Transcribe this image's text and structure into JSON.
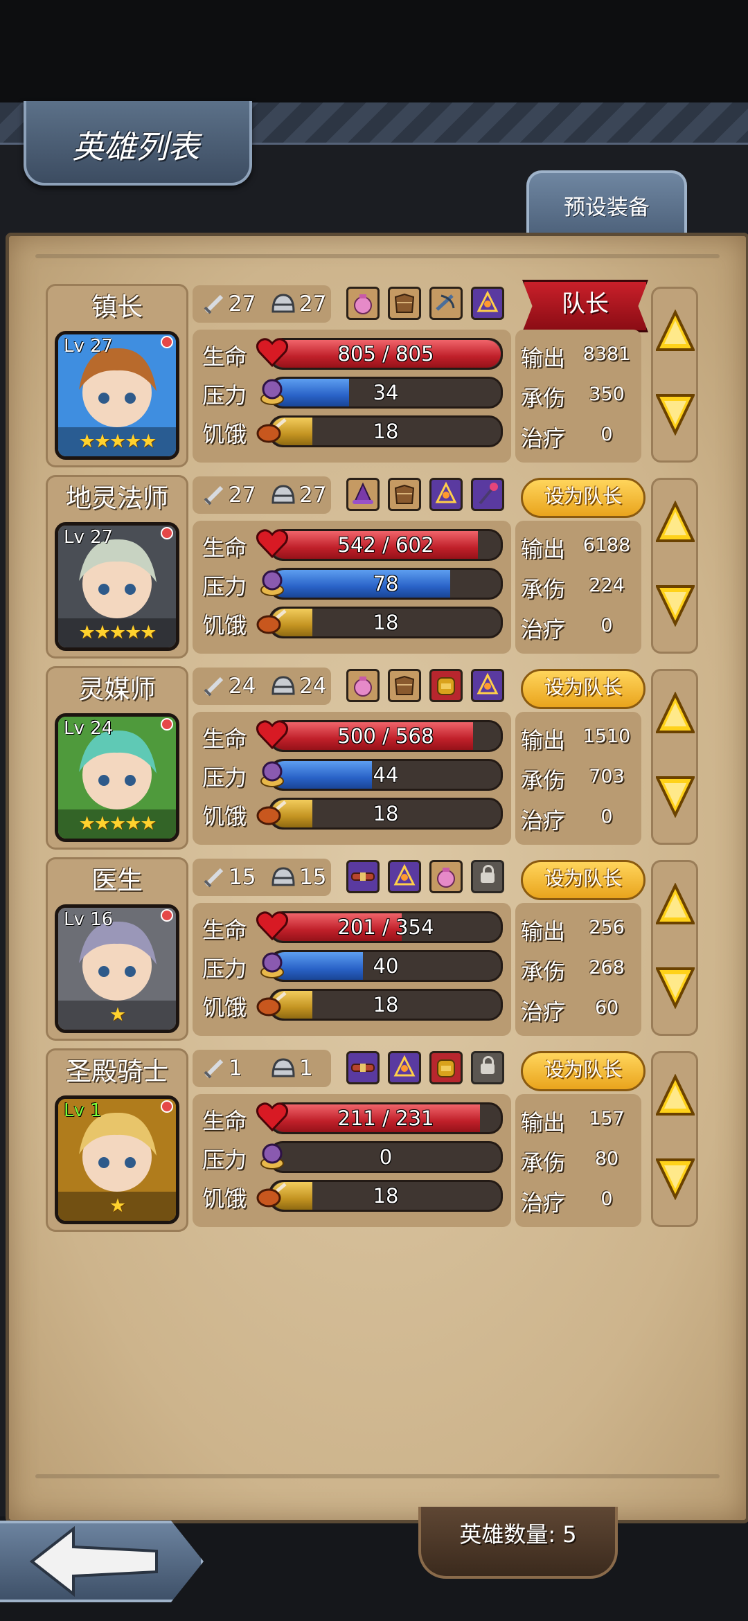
{
  "header": {
    "title": "英雄列表",
    "preset_button": "预设装备"
  },
  "labels": {
    "hp": "生命",
    "stress": "压力",
    "hunger": "饥饿",
    "output": "输出",
    "tank": "承伤",
    "heal": "治疗",
    "set_leader": "设为队长",
    "captain": "队长"
  },
  "colors": {
    "parchment": "#d4bd98",
    "hp_bar": "#c0202a",
    "stress_bar": "#2a63c8",
    "hunger_bar": "#c49422",
    "leader_gold": "#f0b73a",
    "captain_red": "#b0151d"
  },
  "heroes": [
    {
      "name": "镇长",
      "level": "Lv 27",
      "stars": "★★★★★",
      "attack": "27",
      "defense": "27",
      "is_captain": true,
      "equipment": [
        "pink-pouch-icon",
        "leather-armor-icon",
        "crossbow-icon",
        "rune-sigil-icon"
      ],
      "hp": "805 / 805",
      "hp_fraction": 1.0,
      "stress": "34",
      "stress_fraction": 0.34,
      "hunger": "18",
      "hunger_fraction": 0.18,
      "output": "8381",
      "tank": "350",
      "heal": "0",
      "portrait_colors": [
        "#3f8ee0",
        "#b86a2c"
      ]
    },
    {
      "name": "地灵法师",
      "level": "Lv 27",
      "stars": "★★★★★",
      "attack": "27",
      "defense": "27",
      "is_captain": false,
      "equipment": [
        "wizard-hat-icon",
        "leather-armor-icon",
        "rune-sigil-icon",
        "magic-staff-icon"
      ],
      "hp": "542 / 602",
      "hp_fraction": 0.9,
      "stress": "78",
      "stress_fraction": 0.78,
      "hunger": "18",
      "hunger_fraction": 0.18,
      "output": "6188",
      "tank": "224",
      "heal": "0",
      "portrait_colors": [
        "#4a4e55",
        "#c8d3c2"
      ]
    },
    {
      "name": "灵媒师",
      "level": "Lv 24",
      "stars": "★★★★★",
      "attack": "24",
      "defense": "24",
      "is_captain": false,
      "equipment": [
        "pink-pouch-icon",
        "leather-armor-icon",
        "backpack-icon",
        "rune-sigil-icon"
      ],
      "hp": "500 / 568",
      "hp_fraction": 0.88,
      "stress": "44",
      "stress_fraction": 0.44,
      "hunger": "18",
      "hunger_fraction": 0.18,
      "output": "1510",
      "tank": "703",
      "heal": "0",
      "portrait_colors": [
        "#4f9a3c",
        "#5fc9b5"
      ]
    },
    {
      "name": "医生",
      "level": "Lv 16",
      "stars": "★",
      "attack": "15",
      "defense": "15",
      "is_captain": false,
      "equipment": [
        "belt-icon",
        "rune-sigil-icon",
        "pink-pouch-icon",
        "lock-icon"
      ],
      "hp": "201 / 354",
      "hp_fraction": 0.57,
      "stress": "40",
      "stress_fraction": 0.4,
      "hunger": "18",
      "hunger_fraction": 0.18,
      "output": "256",
      "tank": "268",
      "heal": "60",
      "portrait_colors": [
        "#6c6e75",
        "#9a97b8"
      ]
    },
    {
      "name": "圣殿骑士",
      "level": "Lv 1",
      "stars": "★",
      "attack": "1",
      "defense": "1",
      "is_captain": false,
      "equipment": [
        "belt-icon",
        "rune-sigil-icon",
        "backpack-icon",
        "lock-icon"
      ],
      "hp": "211 / 231",
      "hp_fraction": 0.91,
      "stress": "0",
      "stress_fraction": 0.0,
      "hunger": "18",
      "hunger_fraction": 0.18,
      "output": "157",
      "tank": "80",
      "heal": "0",
      "portrait_colors": [
        "#b07c1c",
        "#e8c56a"
      ]
    }
  ],
  "footer": {
    "hero_count": "英雄数量: 5"
  }
}
